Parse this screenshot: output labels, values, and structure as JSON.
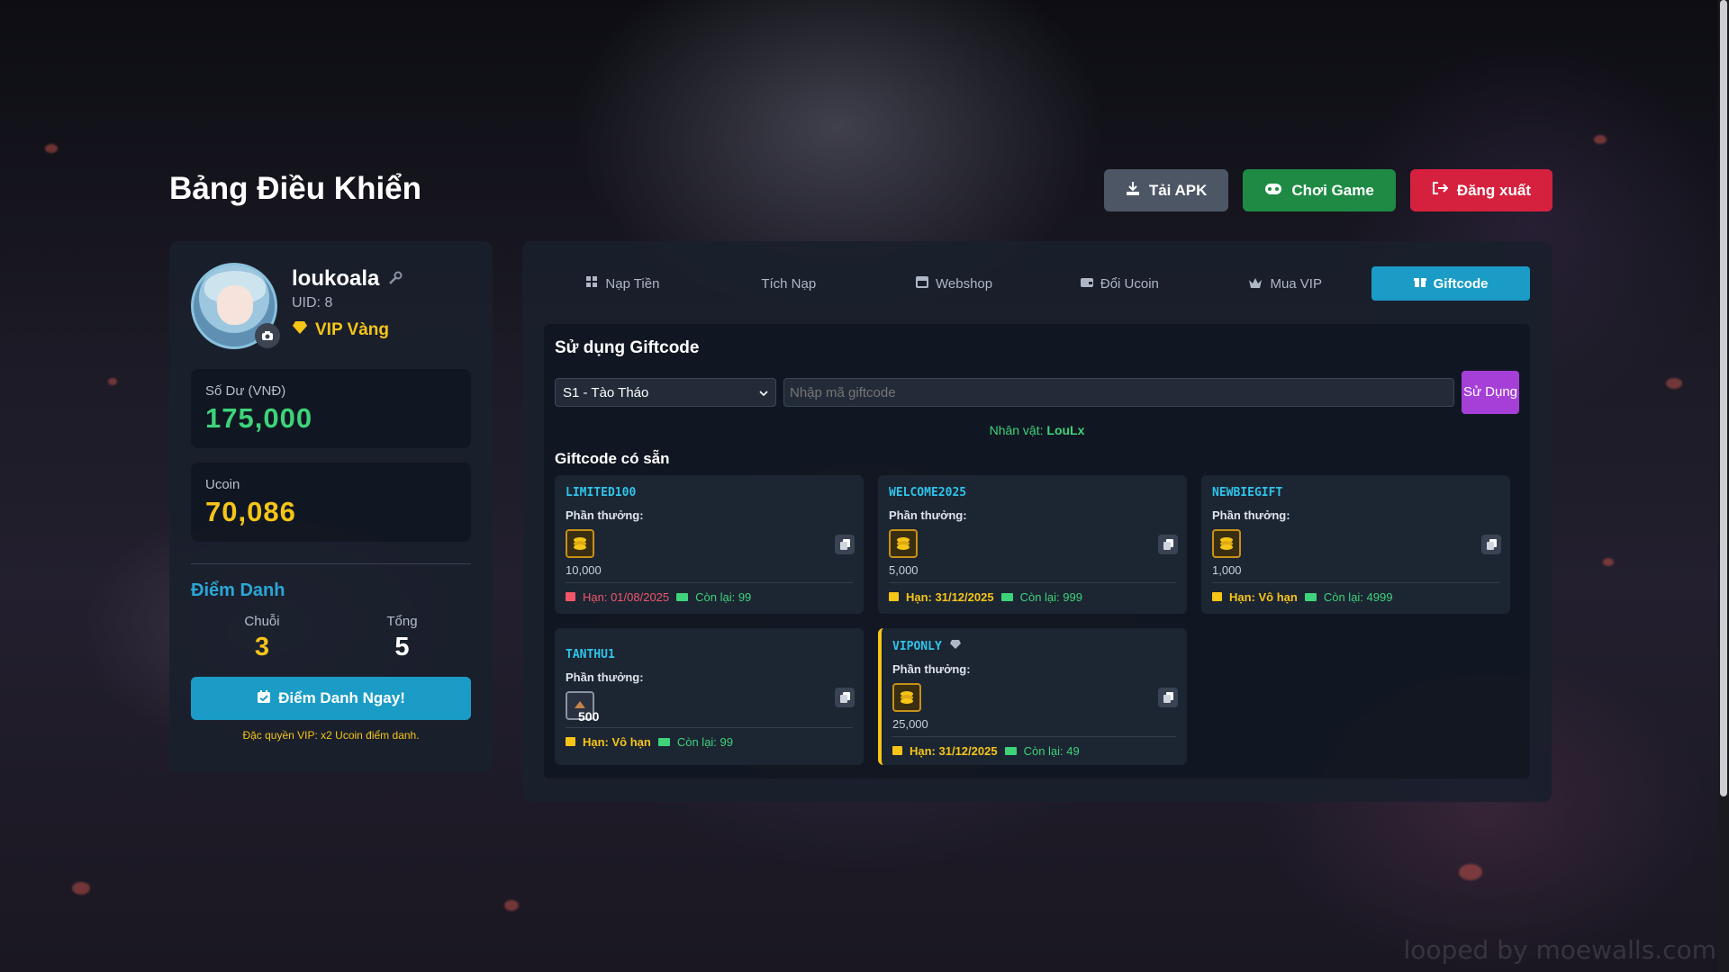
{
  "page": {
    "title": "Bảng Điều Khiển",
    "watermark": "looped by moewalls.com"
  },
  "header_buttons": {
    "apk": "Tải APK",
    "play": "Chơi Game",
    "logout": "Đăng xuất"
  },
  "profile": {
    "username": "loukoala",
    "uid": "UID: 8",
    "vip": "VIP Vàng"
  },
  "balances": {
    "vnd_label": "Số Dư (VNĐ)",
    "vnd_value": "175,000",
    "ucoin_label": "Ucoin",
    "ucoin_value": "70,086"
  },
  "checkin": {
    "title": "Điểm Danh",
    "streak_label": "Chuỗi",
    "streak_value": "3",
    "total_label": "Tổng",
    "total_value": "5",
    "button": "Điểm Danh Ngay!",
    "vip_note": "Đặc quyền VIP: x2 Ucoin điểm danh."
  },
  "tabs": [
    {
      "label": "Nạp Tiền",
      "icon": "grid-icon"
    },
    {
      "label": "Tích Nạp",
      "icon": ""
    },
    {
      "label": "Webshop",
      "icon": "store-icon"
    },
    {
      "label": "Đổi Ucoin",
      "icon": "wallet-icon"
    },
    {
      "label": "Mua VIP",
      "icon": "crown-icon"
    },
    {
      "label": "Giftcode",
      "icon": "gift-icon",
      "active": true
    }
  ],
  "giftcode": {
    "title": "Sử dụng Giftcode",
    "server_selected": "S1 - Tào Tháo",
    "input_placeholder": "Nhập mã giftcode",
    "use_button": "Sử Dụng",
    "character_prefix": "Nhân vật:",
    "character_name": "LouLx",
    "available_title": "Giftcode có sẵn",
    "reward_label": "Phần thưởng:",
    "codes": [
      {
        "code": "LIMITED100",
        "amount": "10,000",
        "expiry": "Hạn: 01/08/2025",
        "remaining": "Còn lại: 99",
        "icon": "coin-stack-icon"
      },
      {
        "code": "WELCOME2025",
        "amount": "5,000",
        "expiry": "Hạn: 31/12/2025",
        "remaining": "Còn lại: 999",
        "icon": "coin-stack-icon"
      },
      {
        "code": "NEWBIEGIFT",
        "amount": "1,000",
        "expiry": "Hạn: Vô hạn",
        "remaining": "Còn lại: 4999",
        "icon": "coin-stack-icon"
      },
      {
        "code": "TANTHU1",
        "amount": "500",
        "expiry": "Hạn: Vô hạn",
        "remaining": "Còn lại: 99",
        "icon": "item-icon"
      },
      {
        "code": "VIPONLY",
        "amount": "25,000",
        "expiry": "Hạn: 31/12/2025",
        "remaining": "Còn lại: 49",
        "icon": "coin-stack-icon",
        "vip": true
      }
    ]
  },
  "colors": {
    "accent": "#1a9cc6",
    "green": "#3ed37a",
    "gold": "#f5c518",
    "red": "#d5213d",
    "purple": "#a63fd8"
  }
}
